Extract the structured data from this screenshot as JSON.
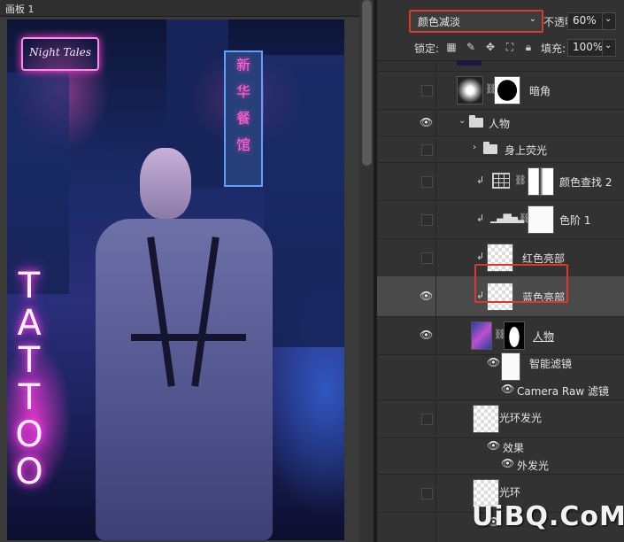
{
  "canvas": {
    "title": "画板 1",
    "neon_night": "Night Tales",
    "neon_tattoo": [
      "T",
      "A",
      "T",
      "T",
      "O",
      "O"
    ],
    "sign_chars": [
      "新",
      "华",
      "餐",
      "馆"
    ]
  },
  "panel": {
    "blend_mode": "颜色减淡",
    "opacity_label": "不透明度:",
    "opacity_value": "60%",
    "lock_label": "锁定:",
    "fill_label": "填充:",
    "fill_value": "100%"
  },
  "layers": [
    {
      "name": "暗角",
      "visible": false
    },
    {
      "name": "人物",
      "visible": true,
      "type": "group"
    },
    {
      "name": "身上荧光",
      "visible": false,
      "type": "group"
    },
    {
      "name": "颜色查找 2",
      "visible": false
    },
    {
      "name": "色阶 1",
      "visible": false
    },
    {
      "name": "红色亮部",
      "visible": false
    },
    {
      "name": "蓝色亮部",
      "visible": true,
      "selected": true
    },
    {
      "name": "人物",
      "visible": true
    },
    {
      "name": "智能滤镜",
      "visible": true
    },
    {
      "name": "Camera Raw 滤镜",
      "visible": true
    },
    {
      "name": "光环发光",
      "visible": false
    },
    {
      "name": "效果",
      "visible": true
    },
    {
      "name": "外发光",
      "visible": true
    },
    {
      "name": "光环",
      "visible": false
    }
  ],
  "watermark": "UiBQ.CoM",
  "colors": {
    "highlight": "#d8392c",
    "panel_bg": "#323232",
    "selected_row": "#4a4a4a"
  }
}
